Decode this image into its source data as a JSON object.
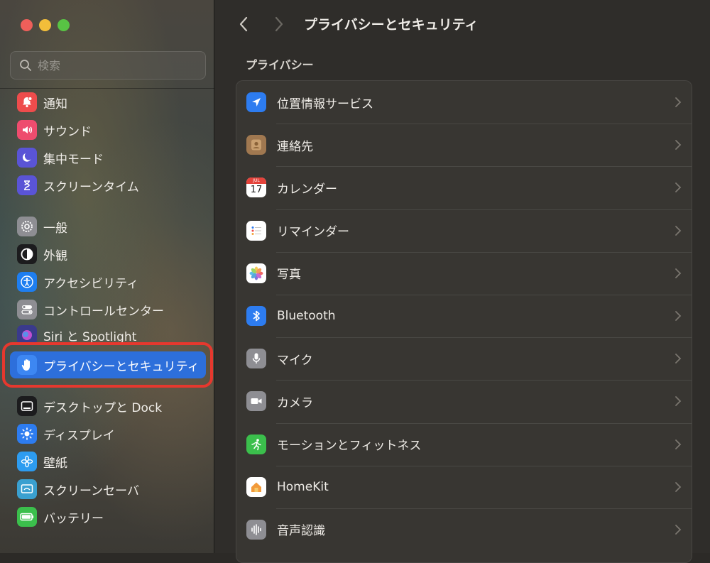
{
  "sidebar": {
    "search_placeholder": "検索",
    "items": [
      {
        "label": "通知",
        "icon": "bell-icon",
        "color": "#ee4c4c"
      },
      {
        "label": "サウンド",
        "icon": "speaker-icon",
        "color": "#ee4c6e"
      },
      {
        "label": "集中モード",
        "icon": "moon-icon",
        "color": "#5a54d6"
      },
      {
        "label": "スクリーンタイム",
        "icon": "hourglass-icon",
        "color": "#5a54d6"
      },
      {
        "label": "一般",
        "icon": "gear-icon",
        "color": "#8e8e93"
      },
      {
        "label": "外観",
        "icon": "appearance-icon",
        "color": "#1c1c1e"
      },
      {
        "label": "アクセシビリティ",
        "icon": "accessibility-icon",
        "color": "#1e7ef0"
      },
      {
        "label": "コントロールセンター",
        "icon": "toggles-icon",
        "color": "#8e8e93"
      },
      {
        "label": "Siri と Spotlight",
        "icon": "siri-icon",
        "color": "#3a3a8c"
      },
      {
        "label": "プライバシーとセキュリティ",
        "icon": "hand-icon",
        "color": "#2d7cf0"
      },
      {
        "label": "デスクトップと Dock",
        "icon": "dock-icon",
        "color": "#1c1c1e"
      },
      {
        "label": "ディスプレイ",
        "icon": "sun-icon",
        "color": "#2d7cf0"
      },
      {
        "label": "壁紙",
        "icon": "flower-icon",
        "color": "#2d9cf0"
      },
      {
        "label": "スクリーンセーバ",
        "icon": "screensaver-icon",
        "color": "#3aa0d0"
      },
      {
        "label": "バッテリー",
        "icon": "battery-icon",
        "color": "#3bbf4c"
      }
    ]
  },
  "main": {
    "title": "プライバシーとセキュリティ",
    "section": "プライバシー",
    "rows": [
      {
        "label": "位置情報サービス",
        "icon": "location-arrow-icon",
        "color": "#2d7cf0"
      },
      {
        "label": "連絡先",
        "icon": "contacts-icon",
        "color": "#a07850"
      },
      {
        "label": "カレンダー",
        "icon": "calendar-icon",
        "color": "#ffffff",
        "month": "JUL",
        "day": "17"
      },
      {
        "label": "リマインダー",
        "icon": "reminders-icon",
        "color": "#ffffff"
      },
      {
        "label": "写真",
        "icon": "photos-icon",
        "color": "#ffffff"
      },
      {
        "label": "Bluetooth",
        "icon": "bluetooth-icon",
        "color": "#2d7cf0"
      },
      {
        "label": "マイク",
        "icon": "microphone-icon",
        "color": "#8e8e93"
      },
      {
        "label": "カメラ",
        "icon": "camera-icon",
        "color": "#8e8e93"
      },
      {
        "label": "モーションとフィットネス",
        "icon": "fitness-icon",
        "color": "#3bbf4c"
      },
      {
        "label": "HomeKit",
        "icon": "home-icon",
        "color": "#ffffff"
      },
      {
        "label": "音声認識",
        "icon": "waveform-icon",
        "color": "#8e8e93"
      }
    ]
  }
}
